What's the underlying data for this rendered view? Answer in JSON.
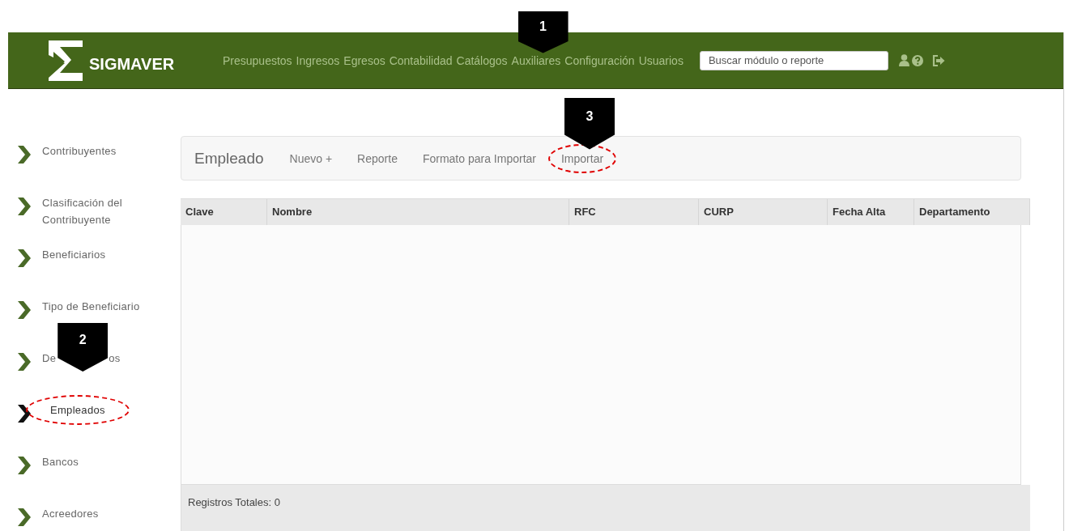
{
  "brand": {
    "name": "SIGMAVER"
  },
  "nav": [
    {
      "label": "Presupuestos"
    },
    {
      "label": "Ingresos"
    },
    {
      "label": "Egresos"
    },
    {
      "label": "Contabilidad"
    },
    {
      "label": "Catálogos"
    },
    {
      "label": "Auxiliares",
      "marker": "1"
    },
    {
      "label": "Configuración"
    },
    {
      "label": "Usuarios"
    }
  ],
  "search": {
    "placeholder": "Buscar módulo o reporte"
  },
  "sidebar": {
    "items": [
      {
        "texts": [
          "Contribuyentes"
        ],
        "selected": false
      },
      {
        "texts": [
          "Clasificación del Contribuyente"
        ],
        "selected": false
      },
      {
        "texts": [
          "Beneficiarios"
        ],
        "selected": false
      },
      {
        "texts": [
          "Tipo de Beneficiario"
        ],
        "selected": false
      },
      {
        "texts": [
          "De",
          "os"
        ],
        "selected": false,
        "marker": "2"
      },
      {
        "texts": [
          "Empleados"
        ],
        "selected": true,
        "highlighted": true
      },
      {
        "texts": [
          "Bancos"
        ],
        "selected": false
      },
      {
        "texts": [
          "Acreedores"
        ],
        "selected": false
      }
    ]
  },
  "toolbar": {
    "title": "Empleado",
    "actions": [
      {
        "label": "Nuevo +",
        "highlighted": false
      },
      {
        "label": "Reporte",
        "highlighted": false
      },
      {
        "label": "Formato para Importar",
        "highlighted": false
      },
      {
        "label": "Importar",
        "highlighted": true,
        "marker": "3"
      }
    ]
  },
  "table": {
    "columns": [
      "Clave",
      "Nombre",
      "RFC",
      "CURP",
      "Fecha Alta",
      "Departamento"
    ],
    "footer": "Registros Totales: 0"
  }
}
